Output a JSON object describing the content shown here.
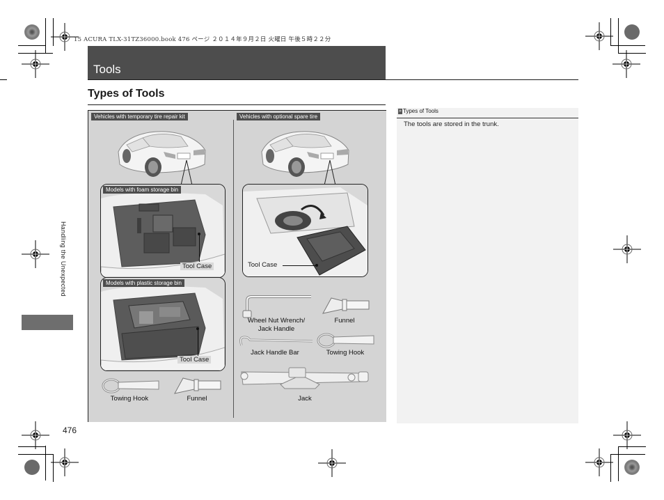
{
  "print_header": "15 ACURA TLX-31TZ36000.book  476 ページ  ２０１４年９月２日  火曜日  午後５時２２分",
  "chapter_title": "Tools",
  "section_title": "Types of Tools",
  "side_tab_label": "Handling the Unexpected",
  "page_number": "476",
  "panel": {
    "left_column_header": "Vehicles with temporary tire repair kit",
    "right_column_header": "Vehicles with optional spare tire",
    "left_insets": [
      {
        "header": "Models with foam storage bin",
        "callout": "Tool Case"
      },
      {
        "header": "Models with plastic storage bin",
        "callout": "Tool Case"
      }
    ],
    "right_inset": {
      "callout": "Tool Case"
    },
    "left_tools": [
      {
        "label": "Towing Hook",
        "icon": "towing-hook-icon"
      },
      {
        "label": "Funnel",
        "icon": "funnel-icon"
      }
    ],
    "right_tools": [
      {
        "label": "Wheel Nut Wrench/\nJack Handle",
        "line1": "Wheel Nut Wrench/",
        "line2": "Jack Handle",
        "icon": "wheel-nut-wrench-icon"
      },
      {
        "label": "Funnel",
        "icon": "funnel-icon"
      },
      {
        "label": "Jack Handle Bar",
        "icon": "jack-handle-bar-icon"
      },
      {
        "label": "Towing Hook",
        "icon": "towing-hook-icon"
      },
      {
        "label": "Jack",
        "icon": "jack-icon"
      }
    ]
  },
  "note": {
    "header_icon": "double-chevron-right-icon",
    "header_icon_glyph": "»",
    "header": "Types of Tools",
    "body": "The tools are stored in the trunk."
  },
  "colors": {
    "title_bar": "#4d4d4d",
    "panel_bg": "#d4d4d4",
    "note_bg": "#f2f2f2",
    "side_tab": "#6e6e6e"
  }
}
